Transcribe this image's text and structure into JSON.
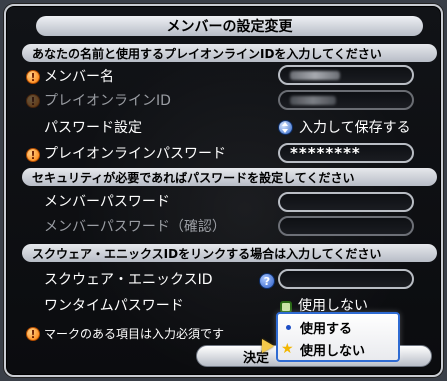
{
  "dialog": {
    "title": "メンバーの設定変更",
    "confirm_label": "決定"
  },
  "sections": {
    "name_and_id": "あなたの名前と使用するプレイオンラインIDを入力してください",
    "security": "セキュリティが必要であればパスワードを設定してください",
    "square_enix": "スクウェア・エニックスIDをリンクする場合は入力してください"
  },
  "fields": {
    "member_name": {
      "label": "メンバー名",
      "required": true
    },
    "playonline_id": {
      "label": "プレイオンラインID",
      "required": true,
      "enabled": false
    },
    "password_setting": {
      "label": "パスワード設定",
      "value": "入力して保存する"
    },
    "playonline_password": {
      "label": "プレイオンラインパスワード",
      "required": true,
      "value": "********"
    },
    "member_password": {
      "label": "メンバーパスワード"
    },
    "member_password_confirm": {
      "label": "メンバーパスワード（確認）",
      "enabled": false
    },
    "square_enix_id": {
      "label": "スクウェア・エニックスID"
    },
    "one_time_password": {
      "label": "ワンタイムパスワード",
      "value": "使用しない"
    }
  },
  "footer_note": "マークのある項目は入力必須です",
  "dropdown": {
    "options": [
      "使用する",
      "使用しない"
    ],
    "selected": "使用しない"
  },
  "icons": {
    "required": "exclamation-icon",
    "save": "up-down-icon",
    "help": "question-icon",
    "one_time_status": "square-icon",
    "selected_option": "star-icon",
    "cursor": "pointer-hand-icon"
  },
  "colors": {
    "required_icon": "#ff7a00",
    "help_icon": "#2a5cc7",
    "dropdown_border": "#2f6bd2",
    "panel_background": "#0b0c0f"
  }
}
